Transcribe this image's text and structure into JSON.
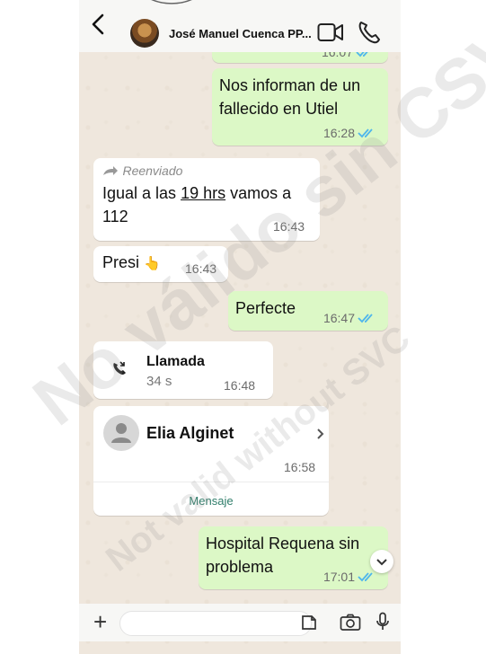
{
  "header": {
    "title": "José Manuel Cuenca PP...",
    "partial_time": "16:07"
  },
  "messages": {
    "m1": {
      "text": "Nos informan de un fallecido en Utiel",
      "time": "16:28"
    },
    "m2": {
      "forwarded": "Reenviado",
      "text_a": "Igual a las ",
      "text_link": "19 hrs",
      "text_b": " vamos a 112",
      "time": "16:43"
    },
    "m3": {
      "text": "Presi",
      "emoji": "👆",
      "time": "16:43"
    },
    "m4": {
      "text": "Perfecte",
      "time": "16:47"
    },
    "m5": {
      "title": "Llamada",
      "duration": "34 s",
      "time": "16:48"
    },
    "m6": {
      "name": "Elia Alginet",
      "time": "16:58",
      "action": "Mensaje"
    },
    "m7": {
      "text": "Hospital Requena sin problema",
      "time": "17:01"
    }
  },
  "watermark": {
    "line1": "No válido sin CSV",
    "line2": "Not valid without SVC"
  },
  "colors": {
    "outgoing_bubble": "#dcf8c6",
    "incoming_bubble": "#ffffff",
    "chat_bg": "#efe7dd",
    "read_ticks": "#4fb6ec"
  }
}
